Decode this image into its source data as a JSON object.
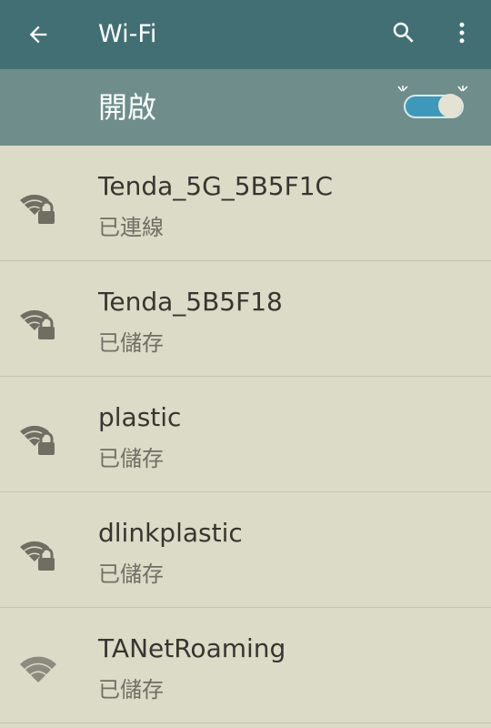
{
  "toolbar": {
    "title": "Wi-Fi",
    "back_icon": "arrow-back-icon",
    "search_icon": "search-icon",
    "more_icon": "more-vert-icon"
  },
  "switch": {
    "label": "開啟",
    "state": "on",
    "accent_color": "#3e98b9"
  },
  "networks": [
    {
      "ssid": "Tenda_5G_5B5F1C",
      "status": "已連線",
      "icon": "wifi-lock-icon",
      "secured": true
    },
    {
      "ssid": "Tenda_5B5F18",
      "status": "已儲存",
      "icon": "wifi-lock-icon",
      "secured": true
    },
    {
      "ssid": "plastic",
      "status": "已儲存",
      "icon": "wifi-lock-icon",
      "secured": true
    },
    {
      "ssid": "dlinkplastic",
      "status": "已儲存",
      "icon": "wifi-lock-icon",
      "secured": true
    },
    {
      "ssid": "TANetRoaming",
      "status": "已儲存",
      "icon": "wifi-icon",
      "secured": false
    }
  ],
  "colors": {
    "toolbar": "#426f73",
    "switchbar": "#6e8d8b",
    "background": "#dcdbc8"
  }
}
